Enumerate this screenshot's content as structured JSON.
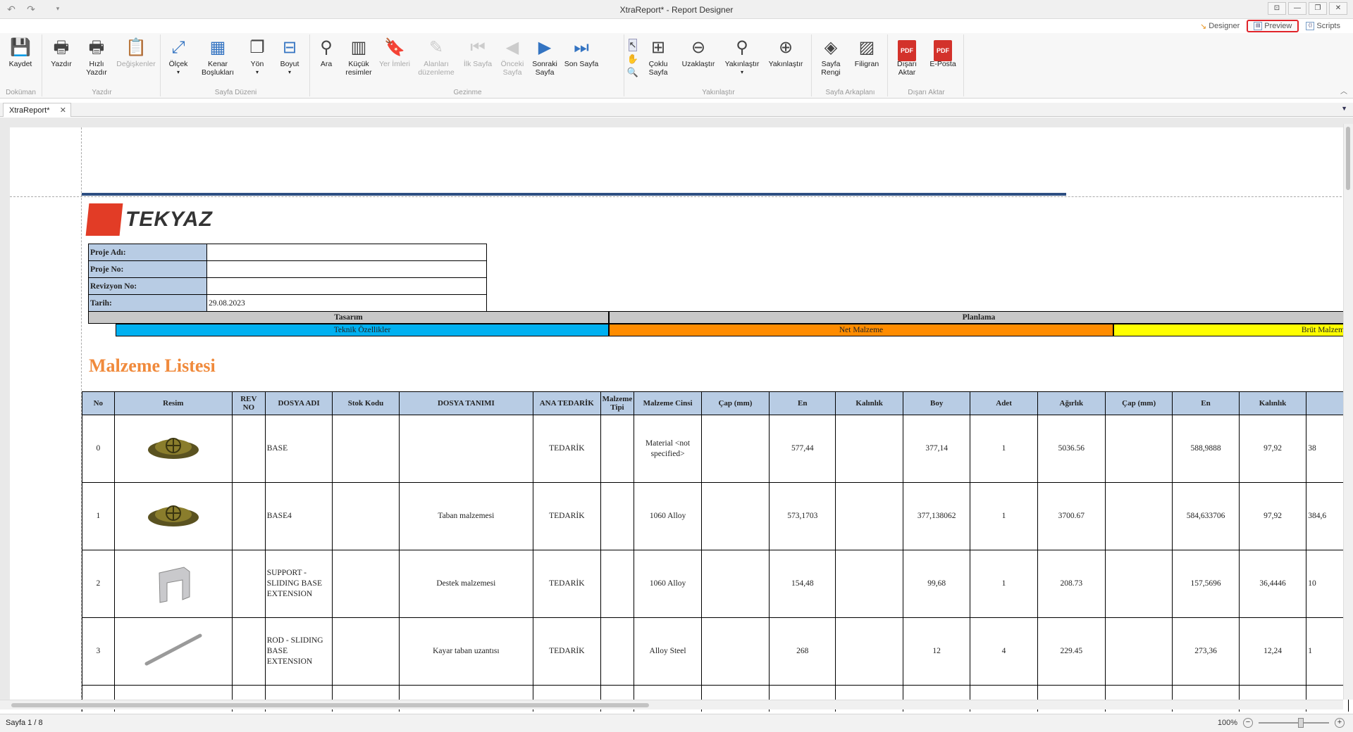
{
  "window": {
    "title": "XtraReport* - Report Designer"
  },
  "view_tabs": [
    {
      "label": "Designer"
    },
    {
      "label": "Preview"
    },
    {
      "label": "Scripts"
    }
  ],
  "ribbon": {
    "doc": {
      "save": "Kaydet",
      "group": "Doküman"
    },
    "print": {
      "print": "Yazdır",
      "quick": "Hızlı Yazdır",
      "params": "Değişkenler",
      "group": "Yazdır"
    },
    "page_setup": {
      "scale": "Ölçek",
      "margins": "Kenar Boşlukları",
      "orientation": "Yön",
      "size": "Boyut",
      "group": "Sayfa Düzeni"
    },
    "nav": {
      "find": "Ara",
      "thumbs": "Küçük resimler",
      "bookmarks": "Yer İmleri",
      "editing": "Alanları düzenleme",
      "first": "İlk Sayfa",
      "prev": "Önceki Sayfa",
      "next": "Sonraki Sayfa",
      "last": "Son Sayfa",
      "group": "Gezinme"
    },
    "zoom": {
      "multi": "Çoklu Sayfa",
      "out": "Uzaklaştır",
      "zoom": "Yakınlaştır",
      "in": "Yakınlaştır",
      "group": "Yakınlaştır"
    },
    "bg": {
      "color": "Sayfa Rengi",
      "watermark": "Filigran",
      "group": "Sayfa Arkaplanı"
    },
    "export": {
      "export": "Dışarı Aktar",
      "email": "E-Posta",
      "group": "Dışarı Aktar",
      "pdf_badge": "PDF"
    }
  },
  "doc_tab": {
    "label": "XtraReport*"
  },
  "report": {
    "logo_text": "TEKYAZ",
    "info": [
      {
        "label": "Proje Adı:",
        "value": ""
      },
      {
        "label": "Proje No:",
        "value": ""
      },
      {
        "label": "Revizyon No:",
        "value": ""
      },
      {
        "label": "Tarih:",
        "value": "29.08.2023"
      }
    ],
    "group_tasarim": "Tasarım",
    "group_planlama": "Planlama",
    "sub_teknik": "Teknik Özellikler",
    "sub_net": "Net Malzeme",
    "sub_brut": "Brüt Malzeme",
    "title": "Malzeme Listesi",
    "columns": [
      "No",
      "Resim",
      "REV NO",
      "DOSYA ADI",
      "Stok Kodu",
      "DOSYA TANIMI",
      "ANA TEDARİK",
      "Malzeme Tipi",
      "Malzeme Cinsi",
      "Çap (mm)",
      "En",
      "Kalınlık",
      "Boy",
      "Adet",
      "Ağırlık",
      "Çap (mm)",
      "En",
      "Kalınlık",
      ""
    ],
    "rows": [
      {
        "no": "0",
        "dosya_adi": "BASE",
        "tanim": "",
        "tedarik": "TEDARİK",
        "cins": "Material <not specified>",
        "en": "577,44",
        "boy": "377,14",
        "adet": "1",
        "agirlik": "5036.56",
        "en2": "588,9888",
        "kalinlik2": "97,92",
        "extra": "38"
      },
      {
        "no": "1",
        "dosya_adi": "BASE4",
        "tanim": "Taban malzemesi",
        "tedarik": "TEDARİK",
        "cins": "1060 Alloy",
        "en": "573,1703",
        "boy": "377,138062",
        "adet": "1",
        "agirlik": "3700.67",
        "en2": "584,633706",
        "kalinlik2": "97,92",
        "extra": "384,6"
      },
      {
        "no": "2",
        "dosya_adi": "SUPPORT - SLIDING BASE EXTENSION",
        "tanim": "Destek malzemesi",
        "tedarik": "TEDARİK",
        "cins": "1060 Alloy",
        "en": "154,48",
        "boy": "99,68",
        "adet": "1",
        "agirlik": "208.73",
        "en2": "157,5696",
        "kalinlik2": "36,4446",
        "extra": "10"
      },
      {
        "no": "3",
        "dosya_adi": "ROD - SLIDING BASE EXTENSION",
        "tanim": "Kayar taban uzantısı",
        "tedarik": "TEDARİK",
        "cins": "Alloy Steel",
        "en": "268",
        "boy": "12",
        "adet": "4",
        "agirlik": "229.45",
        "en2": "273,36",
        "kalinlik2": "12,24",
        "extra": "1"
      }
    ]
  },
  "status": {
    "page": "Sayfa 1 / 8",
    "zoom": "100%"
  },
  "colors": {
    "band": "#2e4f82",
    "header_fill": "#b8cce4",
    "teknik": "#00b0f0",
    "net": "#ff8c00",
    "brut": "#ffff00",
    "title": "#f08a3c",
    "highlight": "#e0242a"
  }
}
